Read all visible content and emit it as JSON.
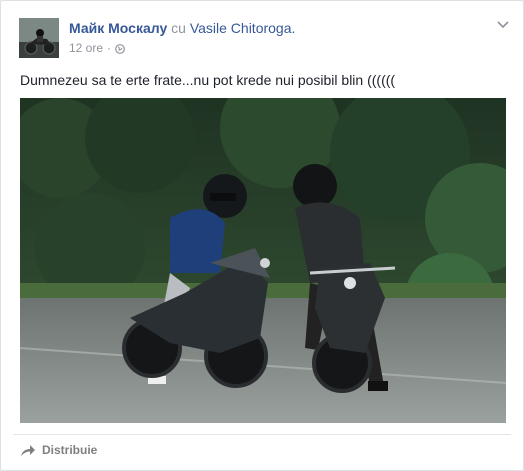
{
  "post": {
    "author": "Майк Москалу",
    "with_word": "cu",
    "tagged_friend": "Vasile Chitoroga.",
    "time": "12 ore",
    "separator": "·",
    "privacy_icon": "globe-icon",
    "menu_icon": "chevron-down-icon",
    "text": "Dumnezeu sa te erte frate...nu pot krede nui posibil blin ((((((",
    "photo_icon": "motorcycle-photo"
  },
  "actions": {
    "share_label": "Distribuie",
    "share_icon": "share-arrow-icon"
  },
  "colors": {
    "link": "#365899",
    "meta": "#90949c",
    "text": "#1d2129",
    "card_border": "#dddfe2",
    "background": "#e9ebee"
  }
}
